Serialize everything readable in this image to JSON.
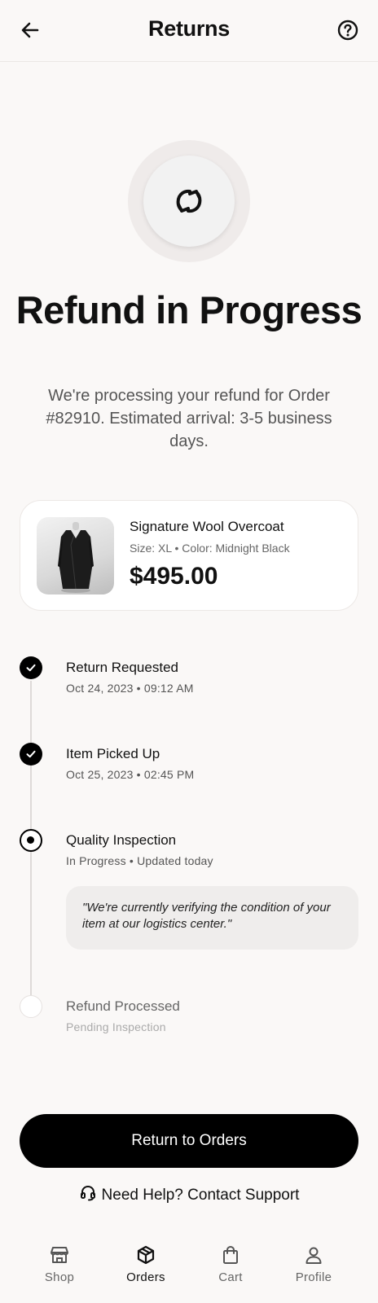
{
  "header": {
    "title": "Returns",
    "back_icon": "arrow-left-icon",
    "help_icon": "help-circle-icon"
  },
  "hero": {
    "icon": "refresh-icon",
    "headline": "Refund in Progress",
    "subtext": "We're processing your refund for Order #82910. Estimated arrival: 3-5 business days."
  },
  "product": {
    "name": "Signature Wool Overcoat",
    "meta": "Size: XL • Color: Midnight Black",
    "price": "$495.00"
  },
  "timeline": {
    "steps": [
      {
        "title": "Return Requested",
        "sub": "Oct 24, 2023 • 09:12 AM",
        "status": "done"
      },
      {
        "title": "Item Picked Up",
        "sub": "Oct 25, 2023 • 02:45 PM",
        "status": "done"
      },
      {
        "title": "Quality Inspection",
        "sub": "In Progress • Updated today",
        "status": "current"
      },
      {
        "title": "Refund Processed",
        "sub": "Pending Inspection",
        "status": "pending"
      }
    ],
    "note": "\"We're currently verifying the condition of your item at our logistics center.\""
  },
  "actions": {
    "primary_label": "Return to Orders",
    "support_label": "Need Help? Contact Support",
    "support_icon": "headset-icon"
  },
  "tabbar": {
    "items": [
      {
        "label": "Shop",
        "icon": "storefront-icon"
      },
      {
        "label": "Orders",
        "icon": "package-icon"
      },
      {
        "label": "Cart",
        "icon": "shopping-bag-icon"
      },
      {
        "label": "Profile",
        "icon": "user-icon"
      }
    ],
    "active": "Orders"
  },
  "colors": {
    "background": "#faf8f7",
    "primary": "#000000",
    "card": "#ffffff",
    "note_background": "#efedec"
  }
}
